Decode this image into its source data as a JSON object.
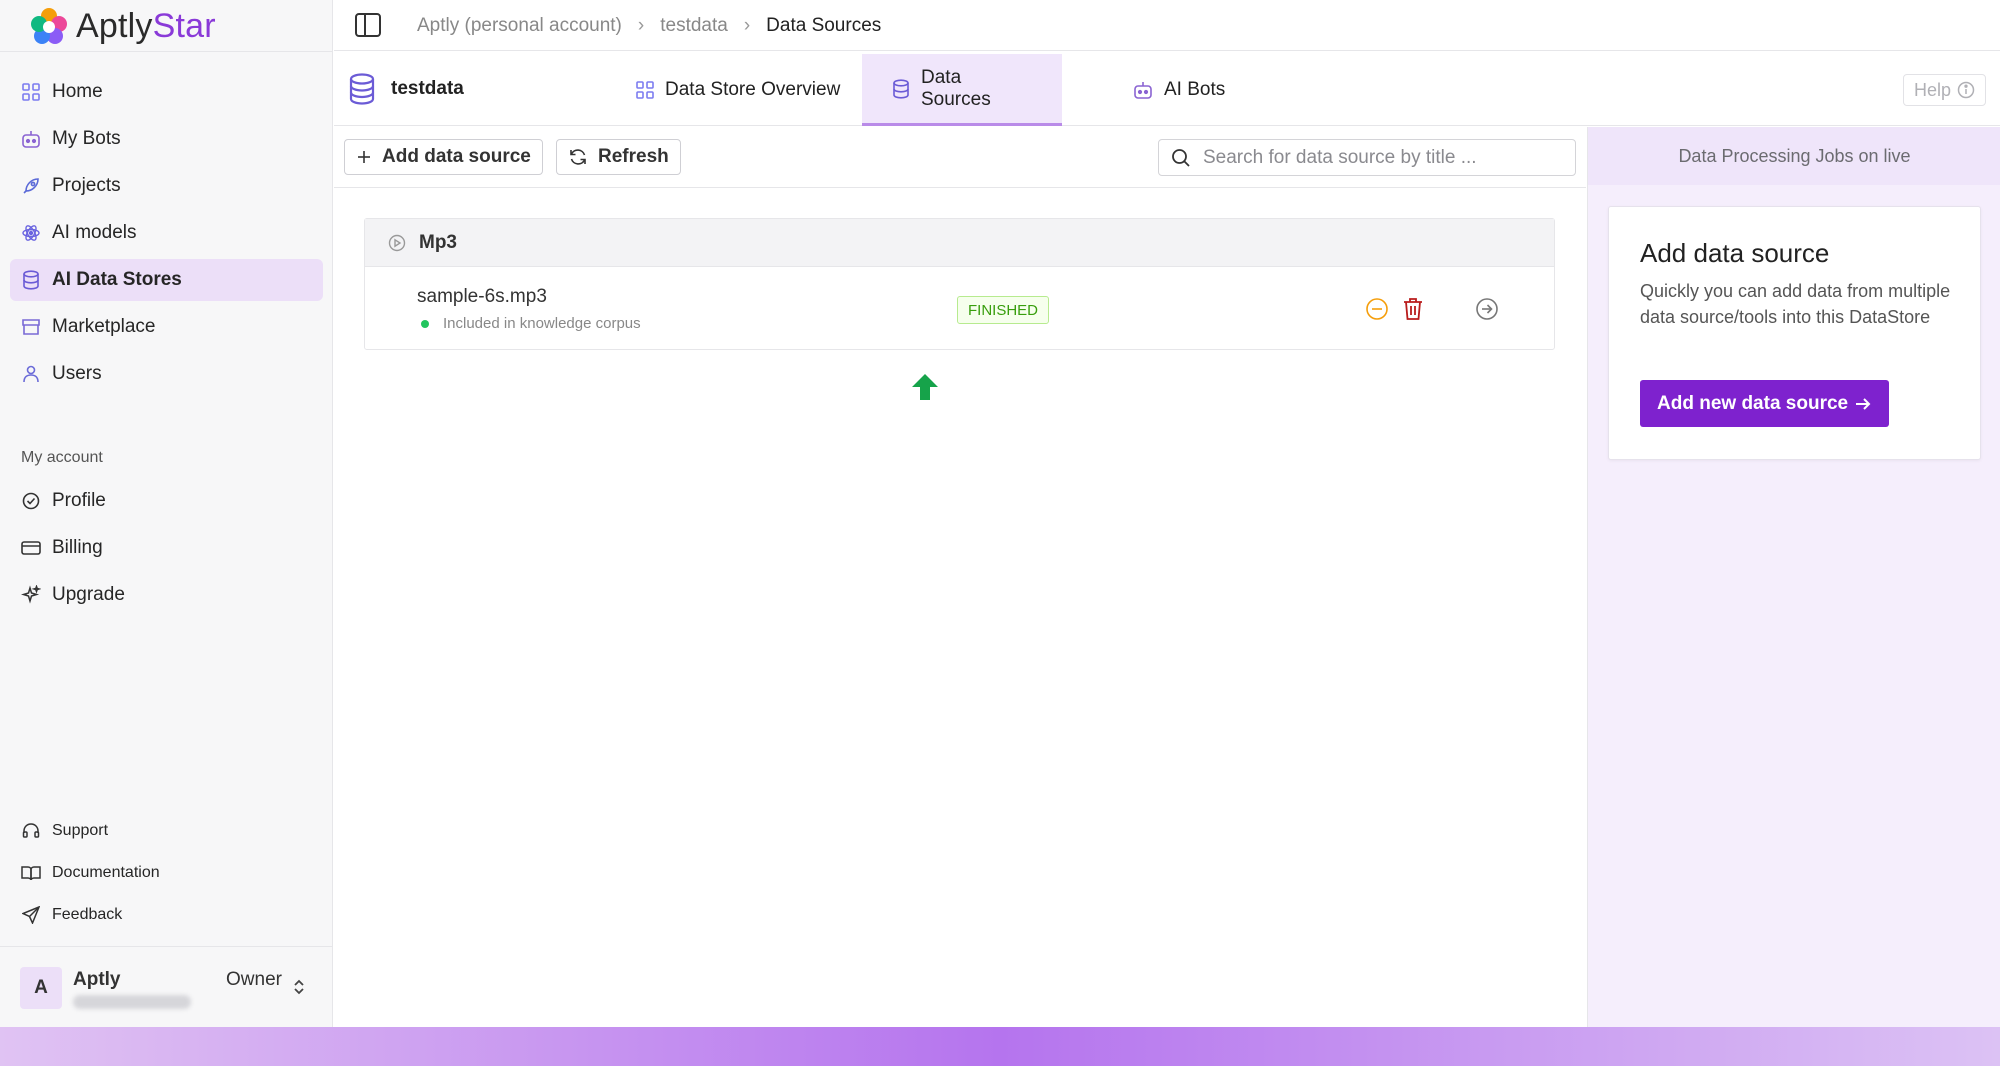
{
  "app": {
    "logo_text_main": "Aptly",
    "logo_text_accent": "Star"
  },
  "sidebar": {
    "items": [
      {
        "label": "Home",
        "icon": "home-icon"
      },
      {
        "label": "My Bots",
        "icon": "bot-icon"
      },
      {
        "label": "Projects",
        "icon": "rocket-icon"
      },
      {
        "label": "AI models",
        "icon": "atom-icon"
      },
      {
        "label": "AI Data Stores",
        "icon": "database-icon",
        "active": true
      },
      {
        "label": "Marketplace",
        "icon": "store-icon"
      },
      {
        "label": "Users",
        "icon": "user-icon"
      }
    ],
    "section_label": "My account",
    "account_items": [
      {
        "label": "Profile",
        "icon": "profile-icon"
      },
      {
        "label": "Billing",
        "icon": "card-icon"
      },
      {
        "label": "Upgrade",
        "icon": "sparkle-icon"
      }
    ],
    "footer_items": [
      {
        "label": "Support",
        "icon": "headset-icon"
      },
      {
        "label": "Documentation",
        "icon": "book-icon"
      },
      {
        "label": "Feedback",
        "icon": "send-icon"
      }
    ],
    "user": {
      "initial": "A",
      "name": "Aptly",
      "role": "Owner"
    }
  },
  "breadcrumb": {
    "items": [
      "Aptly (personal account)",
      "testdata"
    ],
    "current": "Data Sources"
  },
  "datastore": {
    "title": "testdata"
  },
  "tabs": [
    {
      "label": "Data Store Overview"
    },
    {
      "label": "Data Sources",
      "active": true
    },
    {
      "label": "AI Bots"
    }
  ],
  "help_label": "Help",
  "toolbar": {
    "add_label": "Add data source",
    "refresh_label": "Refresh",
    "search_placeholder": "Search for data source by title ..."
  },
  "group": {
    "name": "Mp3",
    "items": [
      {
        "file": "sample-6s.mp3",
        "status": "Included in knowledge corpus",
        "badge": "FINISHED"
      }
    ]
  },
  "right_panel": {
    "title": "Data Processing Jobs on live",
    "card_title": "Add data source",
    "card_desc": "Quickly you can add data from multiple data source/tools into this DataStore",
    "card_button": "Add new data source"
  },
  "colors": {
    "accent": "#7e22ce",
    "active_bg": "#ecdff8",
    "success": "#22c55e",
    "danger": "#b91c1c",
    "warning": "#f59e0b",
    "arrow": "#16a34a"
  }
}
